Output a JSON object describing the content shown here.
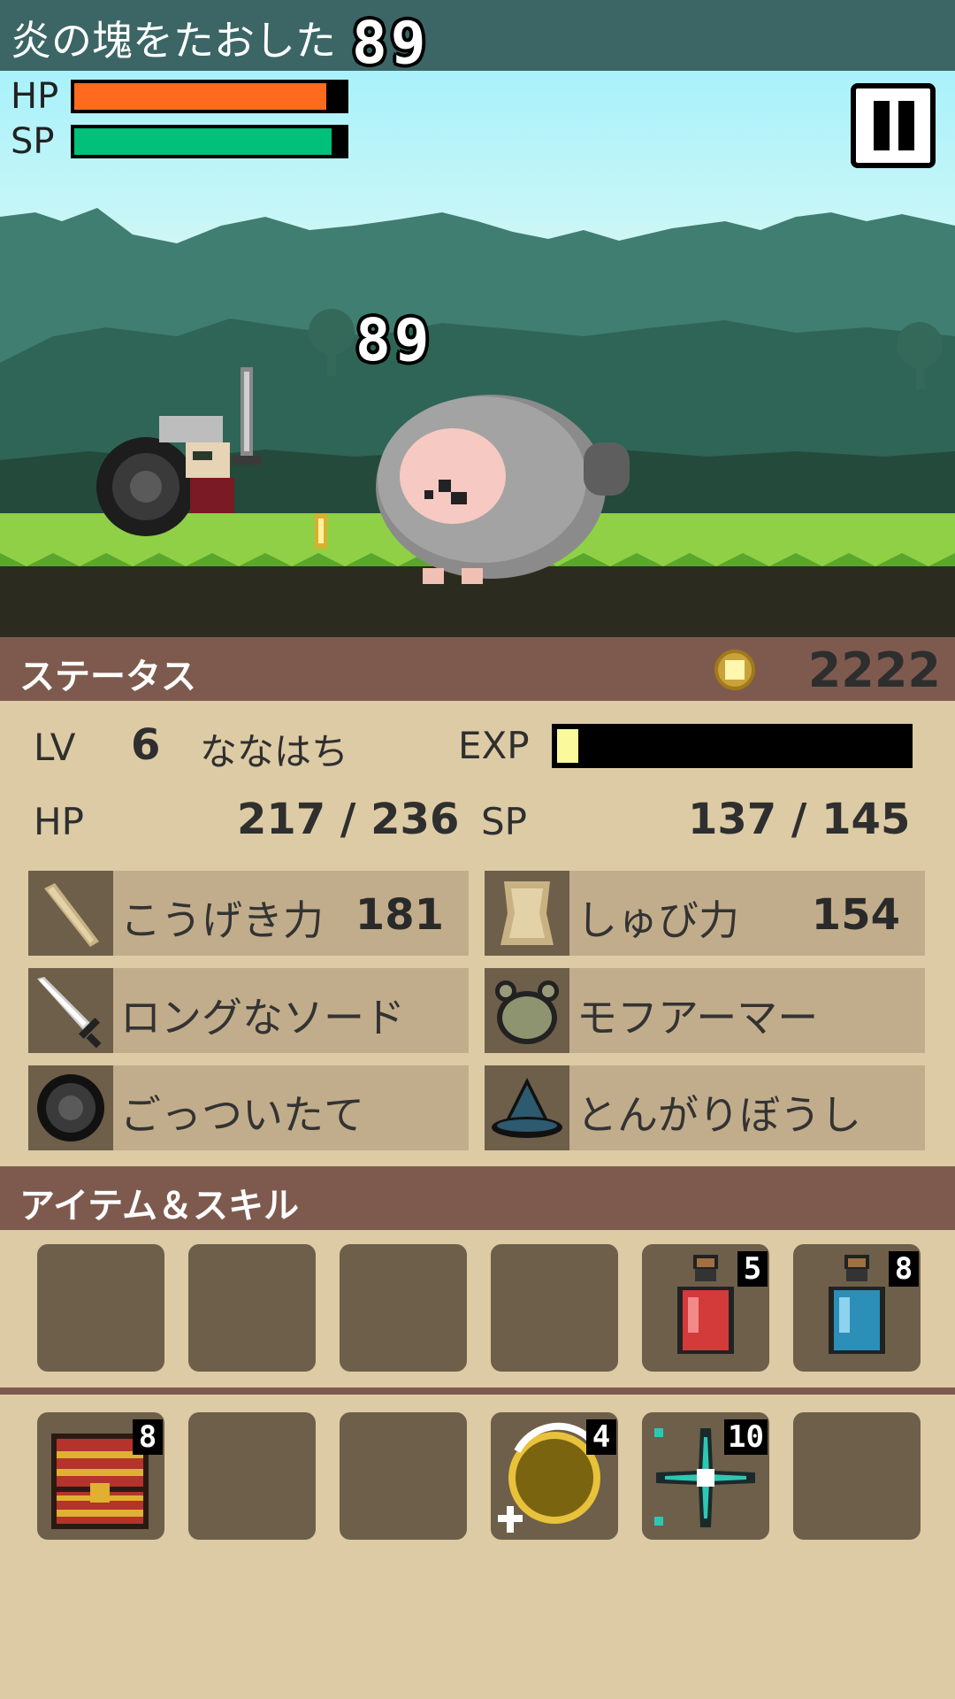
{
  "message": {
    "text": "炎の塊をたおした",
    "damage": "89"
  },
  "hud": {
    "hp_label": "HP",
    "sp_label": "SP",
    "hp_fill": 0.93,
    "sp_fill": 0.95,
    "hp_color": "#ff6a1f",
    "sp_color": "#00c07a",
    "pause_icon": "pause-icon"
  },
  "scene": {
    "damage_popup": "89"
  },
  "status": {
    "title": "ステータス",
    "gold": "2222",
    "lv_label": "LV",
    "lv_value": "6",
    "player_name": "ななはち",
    "exp_label": "EXP",
    "exp_fill": 0.05,
    "hp_label": "HP",
    "hp_value": "217 / 236",
    "sp_label": "SP",
    "sp_value": "137 / 145",
    "attack": {
      "label": "こうげき力",
      "value": "181",
      "icon": "attack-icon"
    },
    "defense": {
      "label": "しゅび力",
      "value": "154",
      "icon": "defense-icon"
    },
    "weapon": {
      "label": "ロングなソード",
      "icon": "sword-icon"
    },
    "armor": {
      "label": "モフアーマー",
      "icon": "armor-icon"
    },
    "shield": {
      "label": "ごっついたて",
      "icon": "shield-icon"
    },
    "helmet": {
      "label": "とんがりぼうし",
      "icon": "hat-icon"
    }
  },
  "items": {
    "title": "アイテム＆スキル",
    "row1": [
      {
        "icon": "",
        "count": ""
      },
      {
        "icon": "",
        "count": ""
      },
      {
        "icon": "",
        "count": ""
      },
      {
        "icon": "",
        "count": ""
      },
      {
        "icon": "red-potion-icon",
        "count": "5"
      },
      {
        "icon": "blue-potion-icon",
        "count": "8"
      }
    ],
    "row2": [
      {
        "icon": "treasure-chest-icon",
        "count": "8"
      },
      {
        "icon": "",
        "count": ""
      },
      {
        "icon": "",
        "count": ""
      },
      {
        "icon": "coin-ring-icon",
        "count": "4"
      },
      {
        "icon": "sparkle-skill-icon",
        "count": "10"
      },
      {
        "icon": "",
        "count": ""
      }
    ]
  }
}
